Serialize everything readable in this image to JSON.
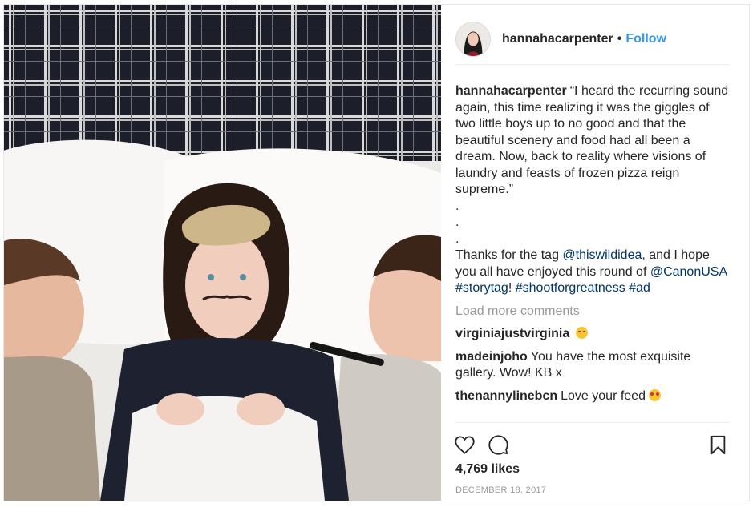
{
  "post": {
    "username": "hannahacarpenter",
    "follow_label": "Follow",
    "dot": "•",
    "caption_lines": [
      "“I heard the recurring sound again, this time realizing it was the giggles of two little boys up to no good and that the beautiful scenery and food had all been a dream. Now, back to reality where visions of laundry and feasts of frozen pizza reign supreme.”",
      ".",
      ".",
      "."
    ],
    "thanks_text_1": "Thanks for the tag ",
    "mention_1": "@thiswildidea",
    "thanks_text_2": ", and I hope you all have enjoyed this round of ",
    "mention_2": "@CanonUSA",
    "hashtag_1": "#storytag",
    "bang": "!",
    "hashtag_2": "#shootforgreatness",
    "hashtag_3": "#ad",
    "load_more": "Load more comments",
    "comments": [
      {
        "user": "virginiajustvirginia",
        "text": "",
        "emoji": "drooling-face"
      },
      {
        "user": "madeinjoho",
        "text": "You have the most exquisite gallery. Wow! KB x",
        "emoji": ""
      },
      {
        "user": "thenannylinebcn",
        "text": "Love your feed",
        "emoji": "heart-eyes-face"
      }
    ],
    "likes": "4,769 likes",
    "date": "DECEMBER 18, 2017"
  },
  "icons": {
    "like": "heart-icon",
    "comment": "comment-bubble-icon",
    "save": "bookmark-icon"
  },
  "colors": {
    "link": "#003569",
    "follow": "#3897f0",
    "muted": "#999999"
  }
}
